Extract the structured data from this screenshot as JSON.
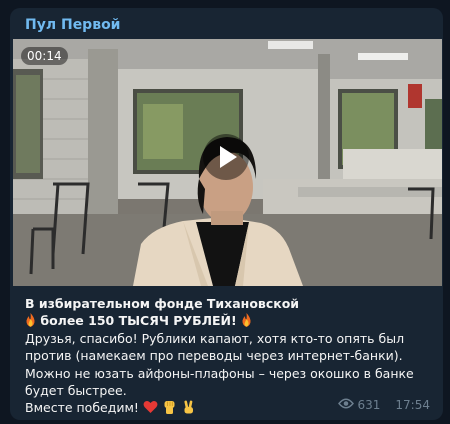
{
  "channel": {
    "name": "Пул Первой"
  },
  "video": {
    "duration": "00:14"
  },
  "post": {
    "headline": "В избирательном фонде Тихановской",
    "highlight": "более 150 ТЫСЯЧ РУБЛЕЙ!",
    "body_lines": [
      "Друзья, спасибо! Рублики капают, хотя кто-то опять был",
      "против (намекаем про переводы через интернет-банки).",
      "Можно не юзать айфоны-плафоны – через окошко в банке",
      "будет быстрее."
    ],
    "closing": "Вместе победим!",
    "emojis": [
      "fire-icon",
      "red-heart-icon",
      "raised-fist-icon",
      "victory-hand-icon"
    ]
  },
  "meta": {
    "views": "631",
    "time": "17:54"
  },
  "colors": {
    "background": "#0e1621",
    "bubble": "#182533",
    "channel_name": "#71baf0",
    "text": "#f5f5f5",
    "meta": "#6d7f8f"
  }
}
